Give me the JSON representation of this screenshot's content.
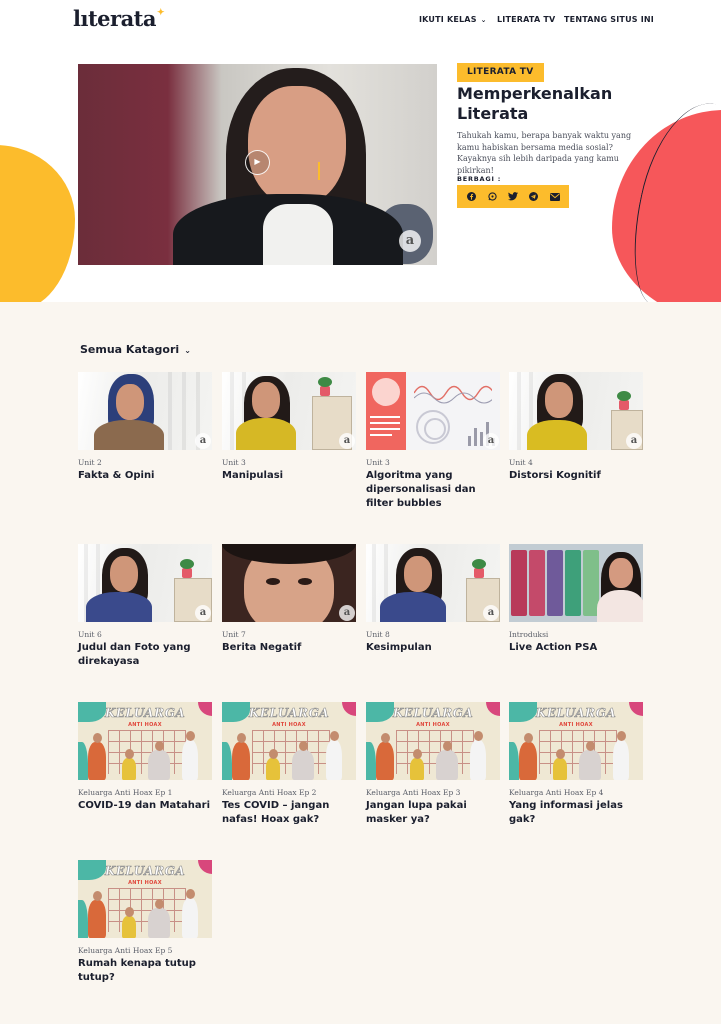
{
  "header": {
    "logo": "lıterata",
    "nav": [
      {
        "label": "IKUTI KELAS",
        "dropdown": true
      },
      {
        "label": "LITERATA TV",
        "dropdown": false
      },
      {
        "label": "TENTANG SITUS INI",
        "dropdown": false
      }
    ]
  },
  "hero": {
    "badge": "LITERATA TV",
    "title": "Memperkenalkan Literata",
    "description": "Tahukah kamu, berapa banyak waktu yang kamu habiskan bersama media sosial? Kayaknya sih lebih daripada yang kamu pikirkan!",
    "share_label": "BERBAGI :",
    "share_icons": [
      "facebook-icon",
      "whatsapp-icon",
      "twitter-icon",
      "telegram-icon",
      "email-icon"
    ],
    "watermark": "a"
  },
  "filter": {
    "label": "Semua Katagori"
  },
  "videos": [
    {
      "unit": "Unit 2",
      "title": "Fakta & Opini"
    },
    {
      "unit": "Unit 3",
      "title": "Manipulasi"
    },
    {
      "unit": "Unit 3",
      "title": "Algoritma yang dipersonalisasi dan filter bubbles"
    },
    {
      "unit": "Unit 4",
      "title": "Distorsi Kognitif"
    },
    {
      "unit": "Unit 6",
      "title": "Judul dan Foto yang direkayasa"
    },
    {
      "unit": "Unit 7",
      "title": "Berita Negatif"
    },
    {
      "unit": "Unit 8",
      "title": "Kesimpulan"
    },
    {
      "unit": "Introduksi",
      "title": "Live Action PSA"
    },
    {
      "unit": "Keluarga Anti Hoax Ep 1",
      "title": "COVID-19 dan Matahari"
    },
    {
      "unit": "Keluarga Anti Hoax Ep 2",
      "title": "Tes COVID – jangan nafas! Hoax gak?"
    },
    {
      "unit": "Keluarga Anti Hoax Ep 3",
      "title": "Jangan lupa pakai masker ya?"
    },
    {
      "unit": "Keluarga Anti Hoax Ep 4",
      "title": "Yang informasi jelas gak?"
    },
    {
      "unit": "Keluarga Anti Hoax Ep 5",
      "title": "Rumah kenapa tutup tutup?"
    }
  ],
  "hoax_thumb": {
    "title": "KELUARGA",
    "subtitle": "ANTI HOAX"
  },
  "colors": {
    "accent_yellow": "#fcbc2c",
    "accent_red": "#f6575a",
    "background": "#faf6f0",
    "text": "#1b1f2e"
  }
}
